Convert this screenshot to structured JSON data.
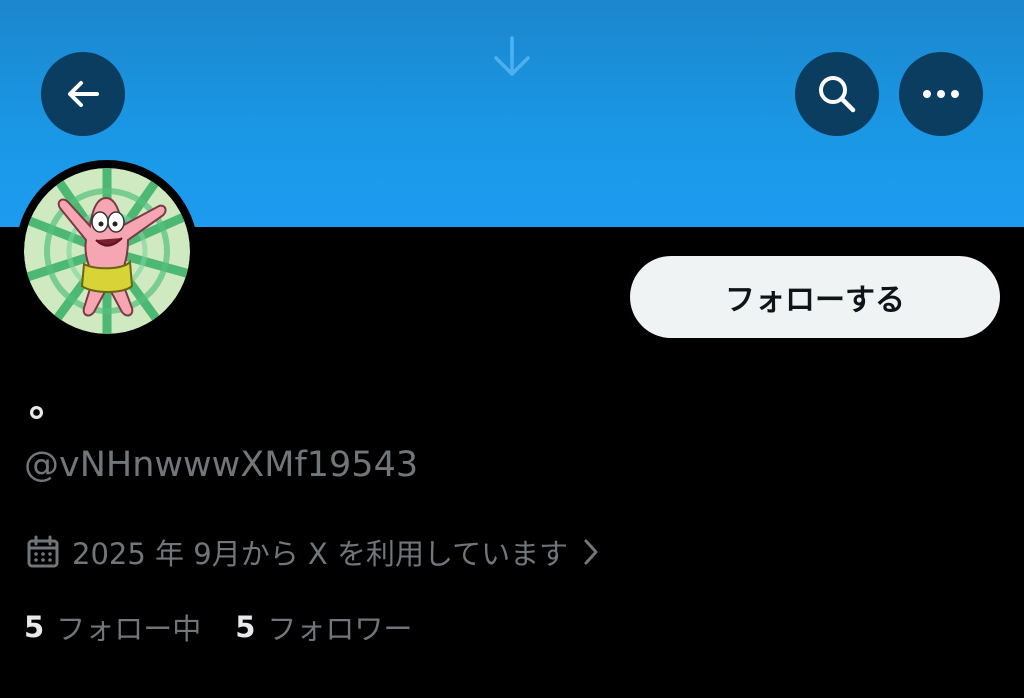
{
  "header": {
    "icons": {
      "pull_indicator": "arrow-down-icon",
      "back": "arrow-left-icon",
      "search": "search-icon",
      "more": "more-horizontal-icon"
    }
  },
  "profile": {
    "display_name": "∘",
    "handle": "@vNHnwwwXMf19543",
    "follow_button_label": "フォローする",
    "joined_text": "2025 年 9月から X を利用しています",
    "joined_icon": "calendar-icon",
    "joined_chevron_icon": "chevron-right-icon",
    "following_count": "5",
    "following_label": "フォロー中",
    "followers_count": "5",
    "followers_label": "フォロワー"
  },
  "colors": {
    "banner": "#1d9bf0",
    "background": "#000000",
    "primary_text": "#e7e9ea",
    "secondary_text": "#71767b",
    "button_bg": "#eff3f4",
    "icon_button_bg": "#0b3d61"
  }
}
